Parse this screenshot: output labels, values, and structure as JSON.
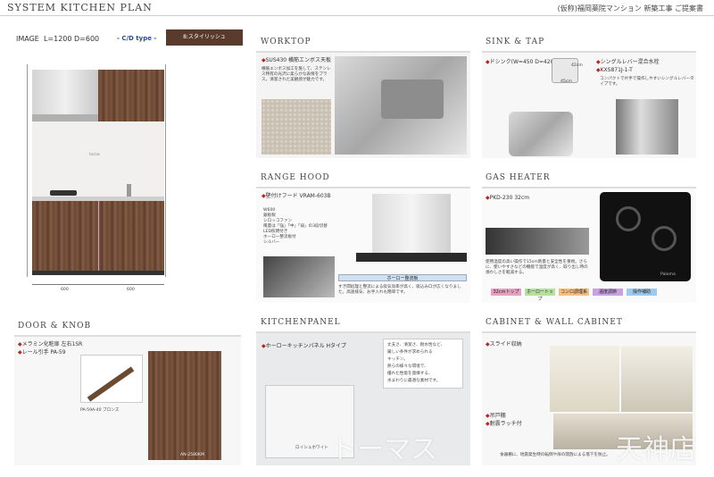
{
  "header": {
    "title": "SYSTEM KITCHEN PLAN",
    "client": "(仮称)福岡薬院マンション 新築工事 ご提案書"
  },
  "image_block": {
    "label": "IMAGE",
    "size": "L=1200 D=600",
    "type_label": "- C/D type -",
    "color_badge": "8:スタイリッシュ",
    "dim_left": "600",
    "dim_right": "600",
    "brand": "toclas"
  },
  "worktop": {
    "heading": "WORKTOP",
    "spec": "SUS430 横筋エンボス天板",
    "desc": "横筋エンボス加工を施して、ステンレス特有の光沢に柔らかな表情をプラス。清潔された美観感が魅力です。"
  },
  "sink": {
    "heading": "SINK & TAP",
    "sink_spec": "ドシンク(W=450 D=420)",
    "tap_spec": "シングルレバー混合水栓",
    "tap_model": "KXS871J-1-T",
    "tap_desc": "コンパクトで片手で操作しやすいシングルレバータイプです。",
    "dim_w": "42cm",
    "dim_d": "45cm"
  },
  "hood": {
    "heading": "RANGE HOOD",
    "spec": "壁付けフード VRAM-603B",
    "features": [
      "W600",
      "銀板製",
      "シロッコファン",
      "風量は「強」「中」「弱」の3段切替",
      "LED照明付き",
      "ホーロー整流板付",
      "シルバー"
    ],
    "badge": "ホーロー整流板",
    "desc": "すき間処理と整流による吸気効率が高く、吸込み口が広くなりました。高速排気、お手入れも簡単です。"
  },
  "gas": {
    "heading": "GAS HEATER",
    "spec": "PKD-230 32cm",
    "desc": "使用温度の高い操作で15cm熱量と安全性を重視。さらに、使いやすさなどの機能で温度が高く、取り出し時の煩わしさを軽減する。",
    "brand": "Paloma",
    "chips": [
      "32cmトップ",
      "ホーロートップ",
      "コンロ調理系",
      "温度調節",
      "操作補助"
    ]
  },
  "door": {
    "heading": "DOOR & KNOB",
    "spec1": "メラミン化粧扉 左右1SR",
    "spec2": "レール引手 PA-59",
    "handle_name": "PA-59A-40 ブロンズ",
    "sample_name": "AN-2580KM"
  },
  "panel": {
    "heading": "KITCHENPANEL",
    "spec": "ホーローキッチンパネル Hタイプ",
    "desc": [
      "丈夫さ、清潔さ、耐水性など、",
      "厳しい条件が求められる",
      "キッチン。",
      "熱らの様々な環境で、",
      "優れた性能を発揮する、",
      "水まわりに最適な素材です。"
    ],
    "sample_label": "ロイシュホワイト"
  },
  "cabinet": {
    "heading": "CABINET & WALL CABINET",
    "spec1": "スライド収納",
    "spec2": "吊戸棚",
    "spec3": "耐震ラッチ付",
    "desc": "食器棚に、地震発生時の転倒や扉の開放による落下を防止。"
  },
  "watermark": {
    "left": "トーマス",
    "right": "天神店"
  }
}
